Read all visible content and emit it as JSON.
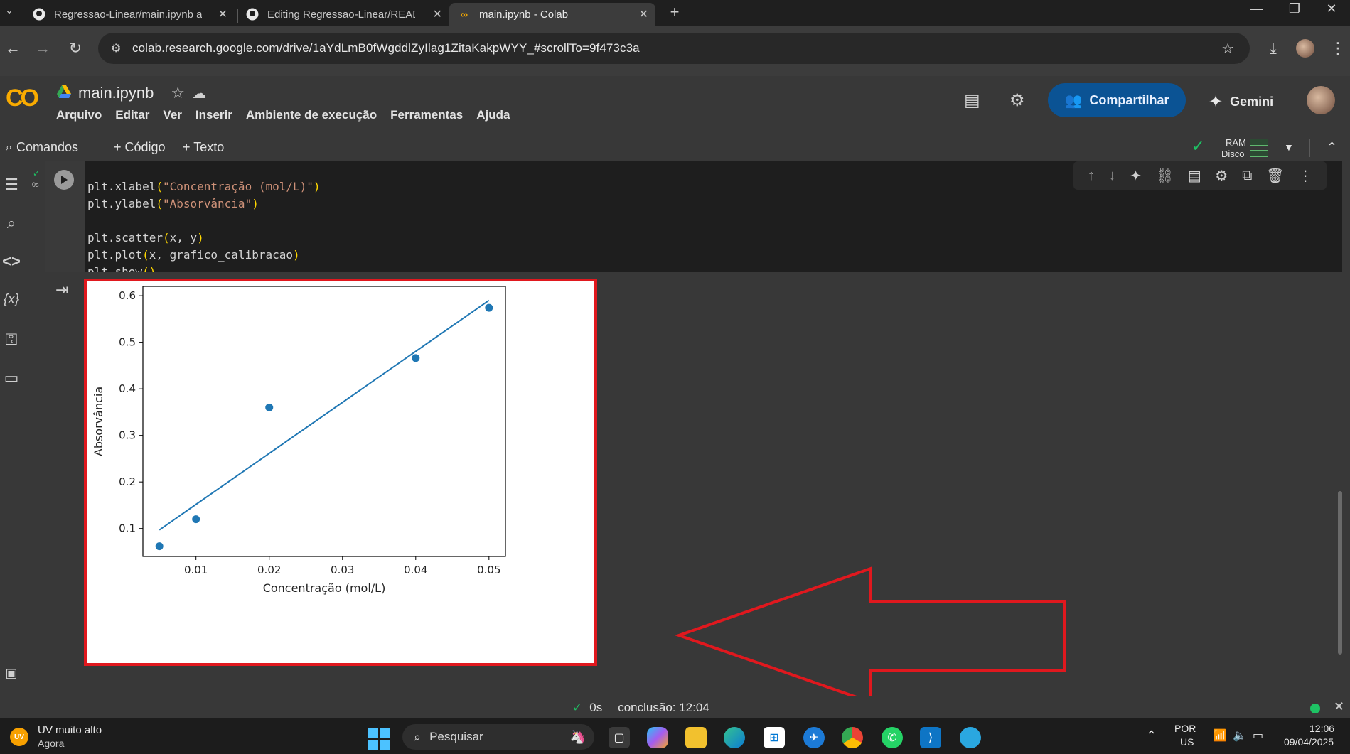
{
  "browser": {
    "tabs": [
      {
        "title": "Regressao-Linear/main.ipynb at",
        "icon": "github-icon"
      },
      {
        "title": "Editing Regressao-Linear/READ",
        "icon": "github-icon"
      },
      {
        "title": "main.ipynb - Colab",
        "icon": "colab-icon"
      }
    ],
    "url": "colab.research.google.com/drive/1aYdLmB0fWgddlZyIlag1ZitaKakpWYY_#scrollTo=9f473c3a"
  },
  "colab": {
    "logo": "CO",
    "notebook_title": "main.ipynb",
    "menu": [
      "Arquivo",
      "Editar",
      "Ver",
      "Inserir",
      "Ambiente de execução",
      "Ferramentas",
      "Ajuda"
    ],
    "share_label": "Compartilhar",
    "gemini_label": "Gemini",
    "commands_label": "Comandos",
    "add_code_label": "+ Código",
    "add_text_label": "+ Texto",
    "ram_label": "RAM",
    "disk_label": "Disco",
    "accent_color": "#f9ab00"
  },
  "cell": {
    "exec_time": "0s",
    "code_lines": [
      {
        "pre": "plt.xlabel",
        "str": "\"Concentração (mol/L)\""
      },
      {
        "pre": "plt.ylabel",
        "str": "\"Absorvância\""
      },
      {
        "pre": "",
        "str": ""
      },
      {
        "pre": "plt.scatter",
        "args": "x, y"
      },
      {
        "pre": "plt.plot",
        "args": "x, grafico_calibracao"
      },
      {
        "pre": "plt.show",
        "args": ""
      }
    ]
  },
  "chart_data": {
    "type": "scatter",
    "xlabel": "Concentração (mol/L)",
    "ylabel": "Absorvância",
    "xlim": [
      0.0,
      0.05
    ],
    "ylim": [
      0.04,
      0.62
    ],
    "xticks": [
      "0.01",
      "0.02",
      "0.03",
      "0.04",
      "0.05"
    ],
    "yticks": [
      "0.1",
      "0.2",
      "0.3",
      "0.4",
      "0.5",
      "0.6"
    ],
    "series": [
      {
        "type": "scatter",
        "x": [
          0.005,
          0.01,
          0.02,
          0.04,
          0.05
        ],
        "y": [
          0.062,
          0.12,
          0.36,
          0.466,
          0.574
        ]
      },
      {
        "type": "line",
        "x": [
          0.005,
          0.05
        ],
        "y": [
          0.097,
          0.59
        ]
      }
    ],
    "grid": false,
    "color": "#1f77b4"
  },
  "status": {
    "time": "0s",
    "completion": "conclusão: 12:04"
  },
  "taskbar": {
    "weather_badge": "UV",
    "weather_title": "UV muito alto",
    "weather_sub": "Agora",
    "search_label": "Pesquisar",
    "lang_top": "POR",
    "lang_bottom": "US",
    "clock_time": "12:06",
    "clock_date": "09/04/2025"
  }
}
